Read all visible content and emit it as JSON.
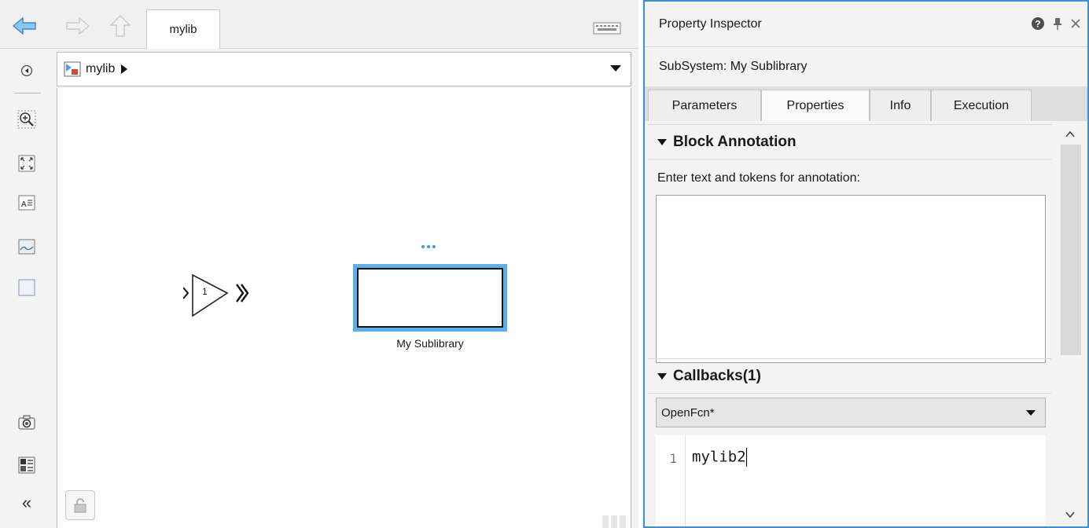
{
  "editor": {
    "nav": {
      "back_icon": "back-arrow-icon",
      "forward_icon": "forward-arrow-icon",
      "up_icon": "up-arrow-icon",
      "tab_label": "mylib",
      "keyboard_icon": "keyboard-icon"
    },
    "address": {
      "path": "mylib",
      "model_icon": "model-icon"
    },
    "toolbar": [
      "hide-show-explorer-icon",
      "zoom-icon",
      "fit-to-view-icon",
      "annotation-icon",
      "image-icon",
      "area-icon",
      "screenshot-icon",
      "report-icon",
      "collapse-icon"
    ],
    "blocks": {
      "inport_number": "1",
      "subsystem_label": "My Sublibrary"
    },
    "accent_color": "#5ab0ea"
  },
  "inspector": {
    "title": "Property Inspector",
    "subtitle": "SubSystem: My Sublibrary",
    "tabs": [
      {
        "label": "Parameters"
      },
      {
        "label": "Properties",
        "active": true
      },
      {
        "label": "Info"
      },
      {
        "label": "Execution"
      }
    ],
    "annotation": {
      "header": "Block Annotation",
      "prompt": "Enter text and tokens for annotation:",
      "value": ""
    },
    "callbacks": {
      "header": "Callbacks(1)",
      "selected": "OpenFcn*",
      "code_line_number": "1",
      "code": "mylib2"
    },
    "frame_color": "#3a8fd6"
  }
}
